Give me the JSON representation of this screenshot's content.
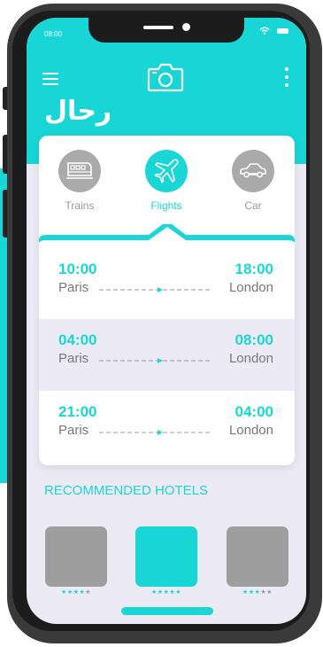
{
  "status": {
    "time": "08:00"
  },
  "header": {
    "logo": "رحال"
  },
  "tabs": [
    {
      "label": "Trains",
      "icon": "train-icon",
      "active": false
    },
    {
      "label": "Flights",
      "icon": "airplane-icon",
      "active": true
    },
    {
      "label": "Car",
      "icon": "car-icon",
      "active": false
    }
  ],
  "flights": [
    {
      "depart_time": "10:00",
      "arrive_time": "18:00",
      "from": "Paris",
      "to": "London"
    },
    {
      "depart_time": "04:00",
      "arrive_time": "08:00",
      "from": "Paris",
      "to": "London"
    },
    {
      "depart_time": "21:00",
      "arrive_time": "04:00",
      "from": "Paris",
      "to": "London"
    }
  ],
  "recommended": {
    "title": "RECOMMENDED HOTELS",
    "hotels": [
      {
        "rating": 4,
        "max": 5
      },
      {
        "rating": 5,
        "max": 5
      },
      {
        "rating": 3,
        "max": 5
      }
    ]
  },
  "colors": {
    "accent": "#1ad6d6",
    "header_bg": "#18d6d6",
    "screen_bg": "#ecebf5"
  }
}
